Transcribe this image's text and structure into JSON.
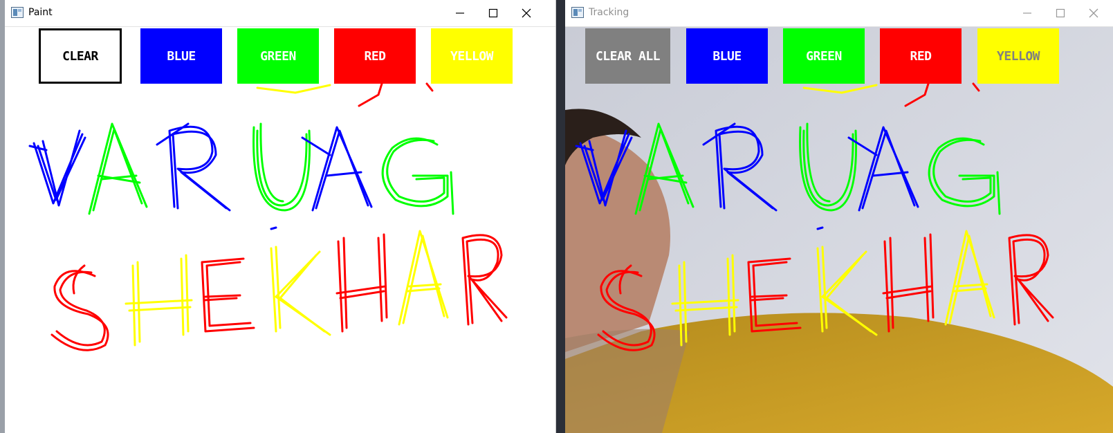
{
  "paint_window": {
    "title": "Paint",
    "icon": "window-app-icon",
    "controls": [
      "minimize-icon",
      "maximize-icon",
      "close-icon"
    ],
    "buttons": [
      {
        "label": "CLEAR",
        "bg": "#ffffff",
        "fg": "#000000"
      },
      {
        "label": "BLUE",
        "bg": "#0000ff",
        "fg": "#ffffff"
      },
      {
        "label": "GREEN",
        "bg": "#00ff00",
        "fg": "#ffffff"
      },
      {
        "label": "RED",
        "bg": "#ff0000",
        "fg": "#ffffff"
      },
      {
        "label": "YELLOW",
        "bg": "#ffff00",
        "fg": "#ffffff"
      }
    ]
  },
  "tracking_window": {
    "title": "Tracking",
    "icon": "window-app-icon",
    "controls": [
      "minimize-icon",
      "maximize-icon",
      "close-icon"
    ],
    "buttons": [
      {
        "label": "CLEAR ALL",
        "bg": "#808080",
        "fg": "#ffffff"
      },
      {
        "label": "BLUE",
        "bg": "#0000ff",
        "fg": "#ffffff"
      },
      {
        "label": "GREEN",
        "bg": "#00ff00",
        "fg": "#ffffff"
      },
      {
        "label": "RED",
        "bg": "#ff0000",
        "fg": "#ffffff"
      },
      {
        "label": "YELLOW",
        "bg": "#ffff00",
        "fg": "#808080"
      }
    ]
  },
  "drawing": {
    "line1": {
      "text": "VARUAG",
      "colors": [
        "#0000ff",
        "#00ff00",
        "#0000ff",
        "#00ff00",
        "#0000ff",
        "#00ff00"
      ]
    },
    "line2": {
      "text": "SHEKHAR",
      "colors": [
        "#ff0000",
        "#ffff00",
        "#ff0000",
        "#ffff00",
        "#ff0000",
        "#ffff00",
        "#ff0000"
      ]
    }
  }
}
